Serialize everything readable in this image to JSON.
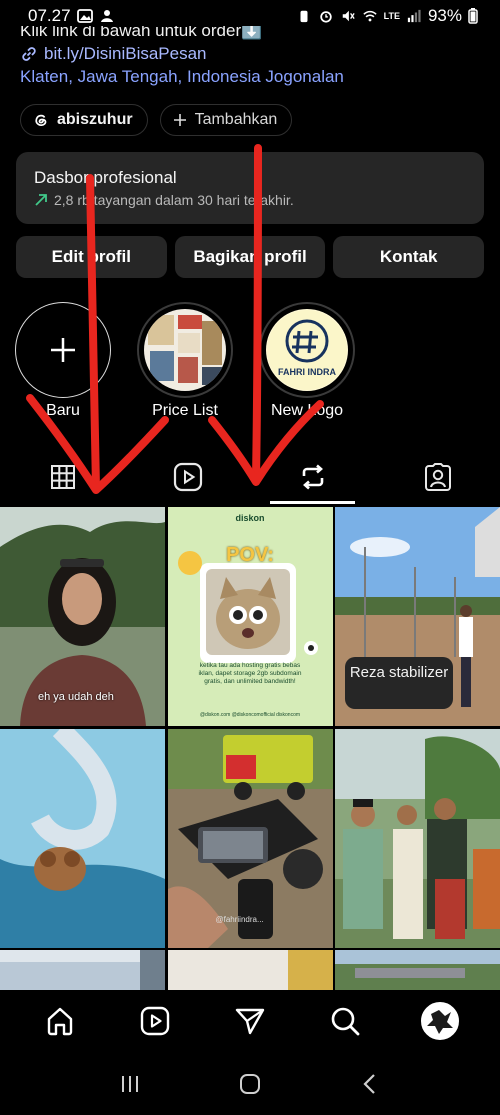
{
  "status_bar": {
    "time": "07.27",
    "battery": "93%",
    "network": "LTE"
  },
  "profile": {
    "bio_cut": "Klik link di bawah untuk order⬇️",
    "link": "bit.ly/DisiniBisaPesan",
    "location": "Klaten, Jawa Tengah, Indonesia Jogonalan",
    "threads_handle": "abiszuhur",
    "add_label": "Tambahkan"
  },
  "dashboard": {
    "title": "Dasbor profesional",
    "subtitle": "2,8 rb tayangan dalam 30 hari terakhir."
  },
  "actions": {
    "edit": "Edit profil",
    "share": "Bagikan profil",
    "contact": "Kontak"
  },
  "highlights": [
    {
      "label": "Baru"
    },
    {
      "label": "Price List"
    },
    {
      "label": "New Logo"
    }
  ],
  "tabs": [
    "grid-icon",
    "reels-icon",
    "reposts-icon",
    "tagged-icon"
  ],
  "posts": [
    {
      "caption": "eh ya udah deh"
    },
    {
      "brand": "diskon",
      "title": "POV:",
      "caption": "ketika tau ada hosting gratis bebas iklan, dapet storage 2gb subdomain gratis, dan unlimited bandwidth!",
      "footer": "@diskon.com   @diskoncomofficial   diskoncom"
    },
    {
      "caption": ""
    },
    {
      "caption": ""
    },
    {
      "caption": "@fahriindra..."
    },
    {
      "caption": ""
    }
  ],
  "tooltip": "Reza stabilizer",
  "logo_text": "FAHRI INDRA",
  "colors": {
    "accent_link": "#a9b9ff",
    "annotation_red": "#e8261f",
    "panel": "#262626"
  }
}
